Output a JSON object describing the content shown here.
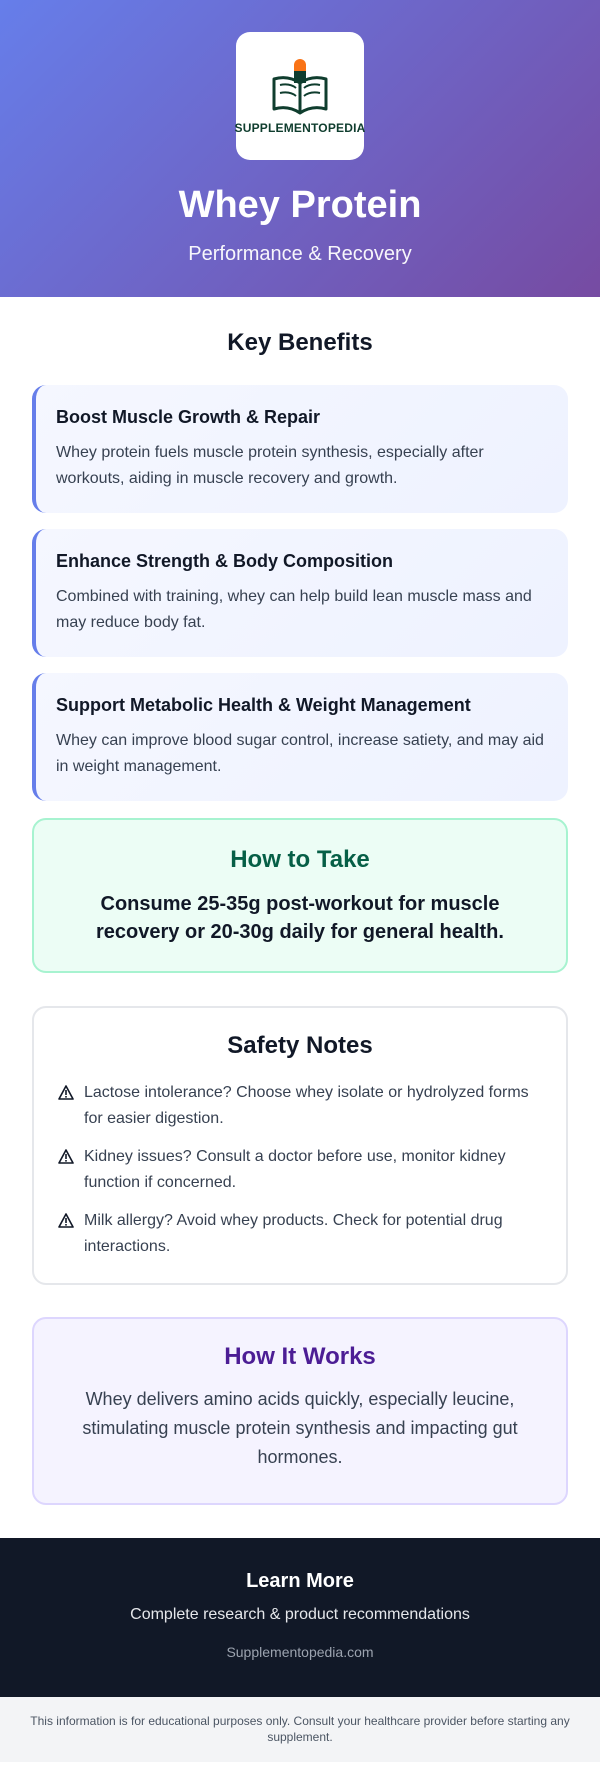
{
  "hero": {
    "logo_text": "SUPPLEMENTOPEDIA",
    "title": "Whey Protein",
    "subtitle": "Performance & Recovery"
  },
  "benefits": {
    "heading": "Key Benefits",
    "items": [
      {
        "title": "Boost Muscle Growth & Repair",
        "desc": "Whey protein fuels muscle protein synthesis, especially after workouts, aiding in muscle recovery and growth."
      },
      {
        "title": "Enhance Strength & Body Composition",
        "desc": "Combined with training, whey can help build lean muscle mass and may reduce body fat."
      },
      {
        "title": "Support Metabolic Health & Weight Management",
        "desc": "Whey can improve blood sugar control, increase satiety, and may aid in weight management."
      }
    ]
  },
  "how_to_take": {
    "title": "How to Take",
    "text": "Consume 25-35g post-workout for muscle recovery or 20-30g daily for general health."
  },
  "safety": {
    "title": "Safety Notes",
    "items": [
      "Lactose intolerance? Choose whey isolate or hydrolyzed forms for easier digestion.",
      "Kidney issues? Consult a doctor before use, monitor kidney function if concerned.",
      "Milk allergy? Avoid whey products. Check for potential drug interactions."
    ]
  },
  "how_it_works": {
    "title": "How It Works",
    "text": "Whey delivers amino acids quickly, especially leucine, stimulating muscle protein synthesis and impacting gut hormones."
  },
  "footer": {
    "title": "Learn More",
    "subtitle": "Complete research & product recommendations",
    "link": "Supplementopedia.com"
  },
  "disclaimer": "This information is for educational purposes only. Consult your healthcare provider before starting any supplement.",
  "colors": {
    "hero_gradient_start": "#667eea",
    "hero_gradient_end": "#764ba2",
    "accent": "#667eea",
    "take_title": "#065f46",
    "works_title": "#4c1d95",
    "footer_bg": "#111827"
  },
  "icons": {
    "logo": "book-capsule-icon",
    "safety": "warning-icon"
  }
}
